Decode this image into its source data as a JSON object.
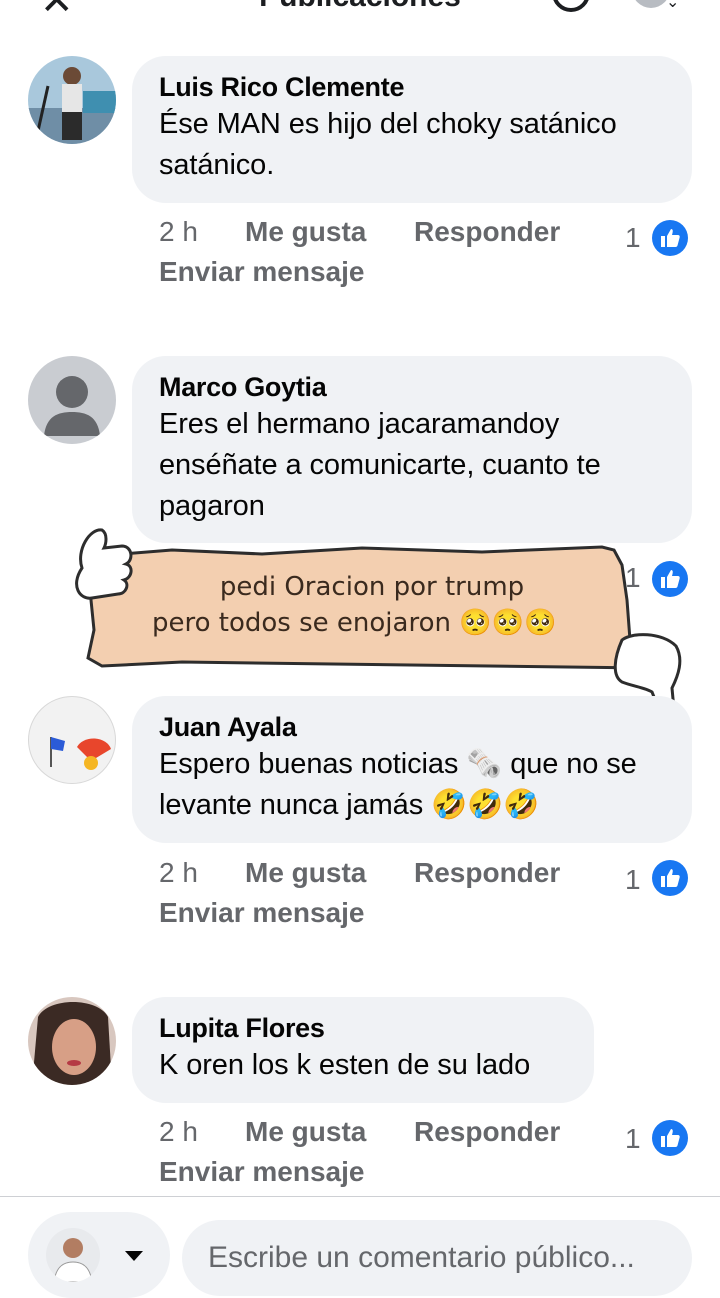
{
  "header": {
    "title": "Publicaciones"
  },
  "comments": [
    {
      "author": "Luis Rico Clemente",
      "text": "Ése MAN es hijo del choky satánico satánico.",
      "time": "2 h",
      "like": "Me gusta",
      "reply": "Responder",
      "message": "Enviar mensaje",
      "reactions": "1"
    },
    {
      "author": "Marco Goytia",
      "text": "Eres el hermano jacaramandoy enséñate a comunicarte, cuanto te pagaron",
      "reactions": "1"
    },
    {
      "author": "Juan Ayala",
      "text": "Espero buenas noticias 🗞️ que no se levante nunca jamás 🤣🤣🤣",
      "time": "2 h",
      "like": "Me gusta",
      "reply": "Responder",
      "message": "Enviar mensaje",
      "reactions": "1"
    },
    {
      "author": "Lupita Flores",
      "text": "K oren los k esten de su lado",
      "time": "2 h",
      "like": "Me gusta",
      "reply": "Responder",
      "message": "Enviar mensaje",
      "reactions": "1"
    }
  ],
  "meme": {
    "line1": "pedi Oracion por trump",
    "line2": "pero todos se enojaron 🥺🥺🥺"
  },
  "composer": {
    "placeholder": "Escribe un comentario público..."
  },
  "colors": {
    "like_blue": "#1877f2",
    "bubble": "#f0f2f5",
    "meta_gray": "#65676b",
    "meme_paper": "#f3cfb0"
  }
}
